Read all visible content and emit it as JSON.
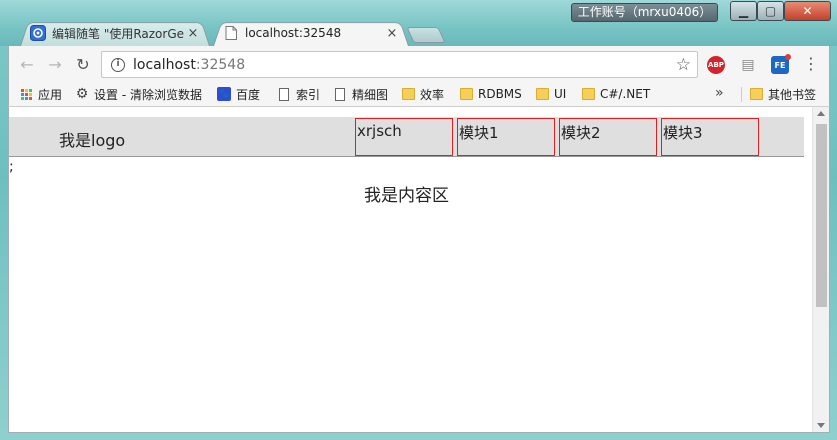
{
  "window": {
    "account_label": "工作账号（mrxu0406）",
    "min_icon": "minimize-icon",
    "max_icon": "maximize-icon",
    "close_icon": "close-icon"
  },
  "tabs": [
    {
      "title": "编辑随笔 \"使用RazorGe",
      "favicon": "cnblogs-icon",
      "active": false,
      "close": "×"
    },
    {
      "title": "localhost:32548",
      "favicon": "page-icon",
      "active": true,
      "close": "×"
    }
  ],
  "toolbar": {
    "url_host": "localhost",
    "url_port": ":32548",
    "abp_label": "ABP",
    "fe_label": "FE"
  },
  "bookmarks": {
    "items": [
      {
        "label": "应用",
        "icon": "apps-icon"
      },
      {
        "label": "设置 - 清除浏览数据",
        "icon": "gear-icon"
      },
      {
        "label": "百度",
        "icon": "baidu-paw-icon"
      },
      {
        "label": "索引",
        "icon": "page-icon"
      },
      {
        "label": "精细图",
        "icon": "page-icon"
      },
      {
        "label": "效率",
        "icon": "folder-icon"
      },
      {
        "label": "RDBMS",
        "icon": "folder-icon"
      },
      {
        "label": "UI",
        "icon": "folder-icon"
      },
      {
        "label": "C#/.NET",
        "icon": "folder-icon"
      }
    ],
    "more": "»",
    "other": "其他书签"
  },
  "page": {
    "logo": "我是logo",
    "nav": [
      "xrjsch",
      "模块1",
      "模块2",
      "模块3"
    ],
    "stray": ";",
    "content": "我是内容区"
  }
}
